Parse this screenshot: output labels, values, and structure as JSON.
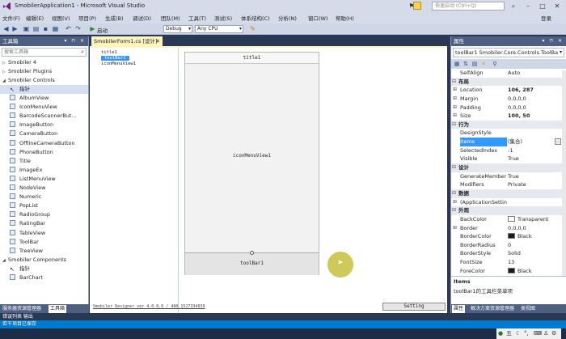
{
  "window": {
    "title": "SmobilerApplication1 - Microsoft Visual Studio",
    "quick_launch_placeholder": "快速启动 (Ctrl+Q)",
    "login": "登录"
  },
  "menu": [
    "文件(F)",
    "编辑(E)",
    "视图(V)",
    "项目(P)",
    "生成(B)",
    "调试(D)",
    "团队(M)",
    "工具(T)",
    "测试(S)",
    "体系结构(C)",
    "分析(N)",
    "窗口(W)",
    "帮助(H)"
  ],
  "toolbar": {
    "start_label": "启动",
    "config": "Debug",
    "platform": "Any CPU"
  },
  "toolbox": {
    "title": "工具箱",
    "search_placeholder": "搜索工具箱",
    "groups": [
      "Smobiler 4",
      "Smobiler Plugins",
      "Smobiler Controls",
      "Smobiler Components"
    ],
    "controls": [
      "指针",
      "AlbumView",
      "IconMenuView",
      "BarcodeScannerBut...",
      "ImageButton",
      "CameraButton",
      "OfflineCameraButton",
      "PhoneButton",
      "Title",
      "ImageEx",
      "ListMenuView",
      "NodeView",
      "Numeric",
      "PopList",
      "RadioGroup",
      "RatingBar",
      "TableView",
      "ToolBar",
      "TreeView"
    ],
    "components": [
      "指针",
      "BarChart"
    ],
    "tabs": [
      "服务器资源管理器",
      "工具箱"
    ]
  },
  "document": {
    "tab_title": "SmobilerForm1.cs [设计]",
    "outline": [
      "title1",
      "toolBar1",
      "iconMenuView1"
    ],
    "phone": {
      "title": "title1",
      "icon_menu": "iconMenuView1",
      "toolbar": "toolBar1"
    },
    "status": "Smobiler Designer ver 4.0.0.0 / 480.1527334039",
    "setting_button": "Setting"
  },
  "properties": {
    "title": "属性",
    "object": "toolBar1  Smobiler.Core.Controls.ToolBa",
    "rows": [
      {
        "kind": "prop",
        "name": "SelfAlign",
        "value": "Auto"
      },
      {
        "kind": "cat",
        "name": "布局"
      },
      {
        "kind": "prop",
        "plus": true,
        "name": "Location",
        "value": "106, 287",
        "bold": true
      },
      {
        "kind": "prop",
        "plus": true,
        "name": "Margin",
        "value": "0,0,0,0"
      },
      {
        "kind": "prop",
        "plus": true,
        "name": "Padding",
        "value": "0,0,0,0"
      },
      {
        "kind": "prop",
        "plus": true,
        "name": "Size",
        "value": "100, 50",
        "bold": true
      },
      {
        "kind": "cat",
        "name": "行为"
      },
      {
        "kind": "prop",
        "name": "DesignStyle",
        "value": ""
      },
      {
        "kind": "prop",
        "name": "Items",
        "value": "(集合)",
        "selected": true,
        "ellipsis": true
      },
      {
        "kind": "prop",
        "name": "SelectedIndex",
        "value": "-1"
      },
      {
        "kind": "prop",
        "name": "Visible",
        "value": "True"
      },
      {
        "kind": "cat",
        "name": "设计"
      },
      {
        "kind": "prop",
        "name": "GenerateMember",
        "value": "True"
      },
      {
        "kind": "prop",
        "name": "Modifiers",
        "value": "Private"
      },
      {
        "kind": "cat",
        "name": "数据"
      },
      {
        "kind": "prop",
        "plus": true,
        "name": "(ApplicationSettin",
        "value": ""
      },
      {
        "kind": "cat",
        "name": "外观"
      },
      {
        "kind": "prop",
        "name": "BackColor",
        "value": "Transparent",
        "swatch": "#ffffff"
      },
      {
        "kind": "prop",
        "plus": true,
        "name": "Border",
        "value": "0,0,0,0"
      },
      {
        "kind": "prop",
        "name": "BorderColor",
        "value": "Black",
        "swatch": "#1a1a1a"
      },
      {
        "kind": "prop",
        "name": "BorderRadius",
        "value": "0"
      },
      {
        "kind": "prop",
        "name": "BorderStyle",
        "value": "Solid"
      },
      {
        "kind": "prop",
        "name": "FontSize",
        "value": "13"
      },
      {
        "kind": "prop",
        "name": "ForeColor",
        "value": "Black",
        "swatch": "#1a1a1a"
      }
    ],
    "desc_title": "Items",
    "desc_text": "toolBar1的工具栏菜单项",
    "tabs": [
      "属性",
      "解决方案资源管理器",
      "类视图"
    ]
  },
  "error_list": "错误列表  输出",
  "status_bar": "若干项目已保存",
  "ime": {
    "label": "五"
  }
}
